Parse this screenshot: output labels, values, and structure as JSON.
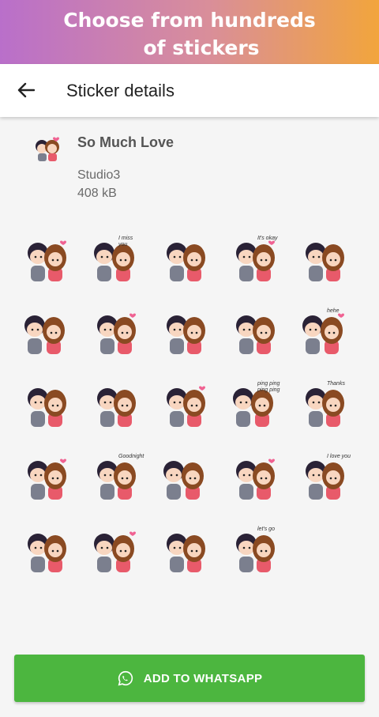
{
  "promo": {
    "line1": "Choose from hundreds",
    "line2": "of stickers"
  },
  "appbar": {
    "title": "Sticker details",
    "back_icon": "arrow-left-icon"
  },
  "pack": {
    "name": "So Much Love",
    "publisher": "Studio3",
    "size": "408 kB",
    "icon": "couple-sticker-icon"
  },
  "stickers": [
    {
      "caption": ""
    },
    {
      "caption": "I miss you"
    },
    {
      "caption": ""
    },
    {
      "caption": "It's okay"
    },
    {
      "caption": ""
    },
    {
      "caption": ""
    },
    {
      "caption": ""
    },
    {
      "caption": ""
    },
    {
      "caption": ""
    },
    {
      "caption": "hehe"
    },
    {
      "caption": ""
    },
    {
      "caption": ""
    },
    {
      "caption": ""
    },
    {
      "caption": "ping ping ping ping"
    },
    {
      "caption": "Thanks"
    },
    {
      "caption": ""
    },
    {
      "caption": "Goodnight"
    },
    {
      "caption": ""
    },
    {
      "caption": ""
    },
    {
      "caption": "I love you"
    },
    {
      "caption": ""
    },
    {
      "caption": ""
    },
    {
      "caption": ""
    },
    {
      "caption": "let's go"
    }
  ],
  "action": {
    "label": "ADD TO WHATSAPP",
    "icon": "whatsapp-icon"
  },
  "colors": {
    "button": "#4cb63f",
    "hair_girl": "#8a4a22",
    "hair_boy": "#2a2236",
    "shirt_boy": "#7b7f8e",
    "shirt_girl": "#e85a6a"
  }
}
